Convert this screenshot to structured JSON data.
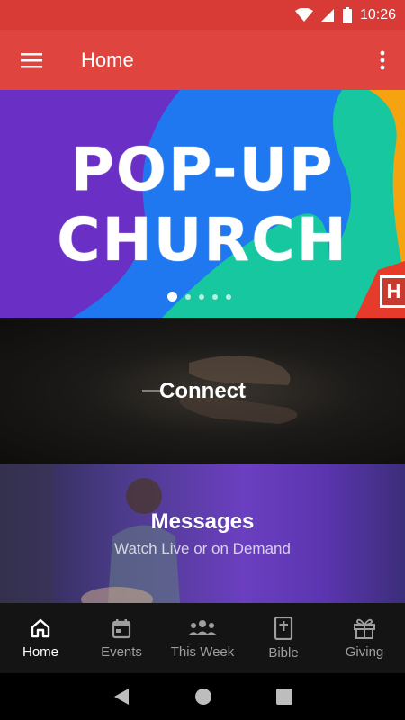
{
  "status_bar": {
    "time": "10:26"
  },
  "app_bar": {
    "title": "Home",
    "menu_icon": "hamburger-menu-icon",
    "overflow_icon": "more-vert-icon"
  },
  "banner": {
    "line1": "POP-UP",
    "line2": "CHURCH",
    "logo": "H",
    "slide_count": 5,
    "active_slide": 1,
    "colors": [
      "#6a2fc4",
      "#1f78f0",
      "#16c7a0",
      "#f5a310"
    ]
  },
  "cards": [
    {
      "title": "Connect",
      "subtitle": ""
    },
    {
      "title": "Messages",
      "subtitle": "Watch Live or on Demand"
    }
  ],
  "bottom_nav": {
    "items": [
      {
        "label": "Home",
        "icon": "home-icon",
        "active": true
      },
      {
        "label": "Events",
        "icon": "calendar-icon",
        "active": false
      },
      {
        "label": "This Week",
        "icon": "group-icon",
        "active": false
      },
      {
        "label": "Bible",
        "icon": "bible-icon",
        "active": false
      },
      {
        "label": "Giving",
        "icon": "gift-icon",
        "active": false
      }
    ]
  },
  "theme": {
    "primary": "#e0443f",
    "status_bar": "#d83b36",
    "nav_bg": "#141414"
  }
}
